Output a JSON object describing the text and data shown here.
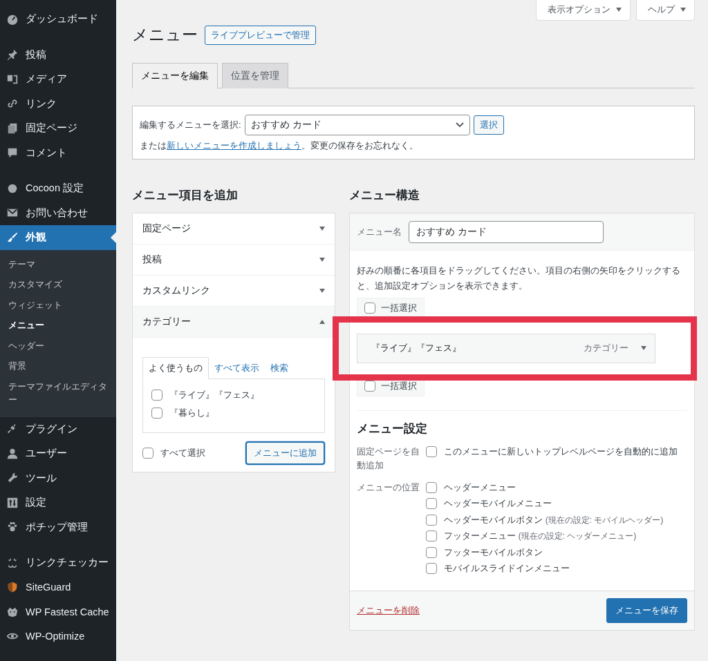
{
  "sidebar": {
    "groups": [
      [
        {
          "label": "ダッシュボード",
          "selected": false
        }
      ],
      [
        {
          "label": "投稿",
          "selected": false
        },
        {
          "label": "メディア",
          "selected": false
        },
        {
          "label": "リンク",
          "selected": false
        },
        {
          "label": "固定ページ",
          "selected": false
        },
        {
          "label": "コメント",
          "selected": false
        }
      ],
      [
        {
          "label": "Cocoon 設定",
          "selected": false
        },
        {
          "label": "お問い合わせ",
          "selected": false
        },
        {
          "label": "外観",
          "selected": true,
          "children": [
            {
              "label": "テーマ",
              "selected": false
            },
            {
              "label": "カスタマイズ",
              "selected": false
            },
            {
              "label": "ウィジェット",
              "selected": false
            },
            {
              "label": "メニュー",
              "selected": true
            },
            {
              "label": "ヘッダー",
              "selected": false
            },
            {
              "label": "背景",
              "selected": false
            },
            {
              "label": "テーマファイルエディター",
              "selected": false
            }
          ]
        },
        {
          "label": "プラグイン",
          "selected": false
        },
        {
          "label": "ユーザー",
          "selected": false
        },
        {
          "label": "ツール",
          "selected": false
        },
        {
          "label": "設定",
          "selected": false
        },
        {
          "label": "ポチップ管理",
          "selected": false
        }
      ],
      [
        {
          "label": "リンクチェッカー",
          "selected": false
        },
        {
          "label": "SiteGuard",
          "selected": false
        },
        {
          "label": "WP Fastest Cache",
          "selected": false
        },
        {
          "label": "WP-Optimize",
          "selected": false
        }
      ]
    ]
  },
  "screen_buttons": [
    "表示オプション",
    "ヘルプ"
  ],
  "page_title": "メニュー",
  "title_button": "ライブプレビューで管理",
  "tabs": [
    {
      "label": "メニューを編集",
      "selected": true
    },
    {
      "label": "位置を管理",
      "selected": false
    }
  ],
  "selector": {
    "label": "編集するメニューを選択:",
    "value": "おすすめ カード",
    "button": "選択",
    "note_before": "または",
    "note_link": "新しいメニューを作成しましょう",
    "note_after": "。変更の保存をお忘れなく。"
  },
  "add_items": {
    "heading": "メニュー項目を追加",
    "sections": [
      {
        "title": "固定ページ",
        "expanded": false
      },
      {
        "title": "投稿",
        "expanded": false
      },
      {
        "title": "カスタムリンク",
        "expanded": false
      },
      {
        "title": "カテゴリー",
        "expanded": true,
        "tabs": [
          {
            "label": "よく使うもの",
            "selected": true
          },
          {
            "label": "すべて表示",
            "selected": false
          },
          {
            "label": "検索",
            "selected": false
          }
        ],
        "items": [
          {
            "label": "『ライブ』『フェス』",
            "checked": false
          },
          {
            "label": "『暮らし』",
            "checked": false
          }
        ],
        "select_all": {
          "label": "すべて選択",
          "checked": false
        },
        "add_button": "メニューに追加"
      }
    ]
  },
  "structure": {
    "heading": "メニュー構造",
    "name_label": "メニュー名",
    "name_value": "おすすめ カード",
    "instructions": "好みの順番に各項目をドラッグしてください。項目の右側の矢印をクリックすると、追加設定オプションを表示できます。",
    "bulk_top": {
      "label": "一括選択",
      "checked": false
    },
    "menu_items": [
      {
        "title": "『ライブ』『フェス』",
        "type": "カテゴリー"
      }
    ],
    "bulk_bottom": {
      "label": "一括選択",
      "checked": false
    },
    "settings_heading": "メニュー設定",
    "auto_add": {
      "label": "固定ページを自動追加",
      "options": [
        {
          "label": "このメニューに新しいトップレベルページを自動的に追加",
          "checked": false
        }
      ]
    },
    "locations": {
      "label": "メニューの位置",
      "options": [
        {
          "label": "ヘッダーメニュー",
          "checked": false
        },
        {
          "label": "ヘッダーモバイルメニュー",
          "checked": false
        },
        {
          "label": "ヘッダーモバイルボタン",
          "note": "(現在の設定: モバイルヘッダー)",
          "checked": false
        },
        {
          "label": "フッターメニュー",
          "note": "(現在の設定: ヘッダーメニュー)",
          "checked": false
        },
        {
          "label": "フッターモバイルボタン",
          "checked": false
        },
        {
          "label": "モバイルスライドインメニュー",
          "checked": false
        }
      ]
    },
    "delete_link": "メニューを削除",
    "save_button": "メニューを保存"
  }
}
